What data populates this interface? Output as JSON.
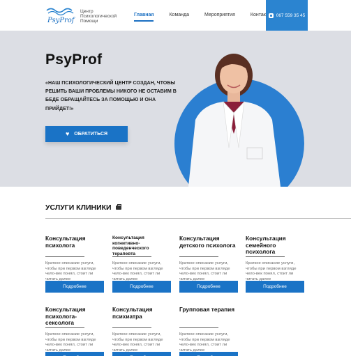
{
  "header": {
    "logo_text": "PsyProf",
    "logo_subtitle": "Центр Психологической Помощи",
    "nav": [
      {
        "label": "Главная",
        "active": true
      },
      {
        "label": "Команда",
        "active": false
      },
      {
        "label": "Мероприятия",
        "active": false
      },
      {
        "label": "Контакты",
        "active": false
      }
    ],
    "phone": "067 559 35 45"
  },
  "hero": {
    "title": "PsyProf",
    "quote": "«НАШ ПСИХОЛОГИЧЕСКИЙ ЦЕНТР СОЗДАН, ЧТОБЫ РЕШИТЬ ВАШИ ПРОБЛЕМЫ НИКОГО НЕ ОСТАВИМ В БЕДЕ ОБРАЩАЙТЕСЬ ЗА ПОМОЩЬЮ И ОНА ПРИЙДЕТ!»",
    "cta_label": "ОБРАТИТЬСЯ"
  },
  "services": {
    "title": "УСЛУГИ КЛИНИКИ",
    "button_label": "Подробнее",
    "cards": [
      {
        "title": "Консультация психолога",
        "desc": "Краткое описание услуги, чтобы при первом взгляде чело-век понял, стоит ли читать далее"
      },
      {
        "title": "Консультация когнитивно-поведенческого терапевта",
        "desc": "Краткое описание услуги, чтобы при первом взгляде чело-век понял, стоит ли читать далее"
      },
      {
        "title": "Консультация детского психолога",
        "desc": "Краткое описание услуги, чтобы при первом взгляде чело-век понял, стоит ли читать далее"
      },
      {
        "title": "Консультация семейного психолога",
        "desc": "Краткое описание услуги, чтобы при первом взгляде чело-век понял, стоит ли читать далее"
      },
      {
        "title": "Консультация психолога-сексолога",
        "desc": "Краткое описание услуги, чтобы при первом взгляде чело-век понял, стоит ли читать далее"
      },
      {
        "title": "Консультация психиатра",
        "desc": "Краткое описание услуги, чтобы при первом взгляде чело-век понял, стоит ли читать далее"
      },
      {
        "title": "Групповая терапия",
        "desc": "Краткое описание услуги, чтобы при первом взгляде чело-век понял, стоит ли читать далее"
      }
    ]
  },
  "colors": {
    "accent": "#1a73c6",
    "hero_bg": "#dcdee4",
    "circle": "#2b7fd1"
  }
}
